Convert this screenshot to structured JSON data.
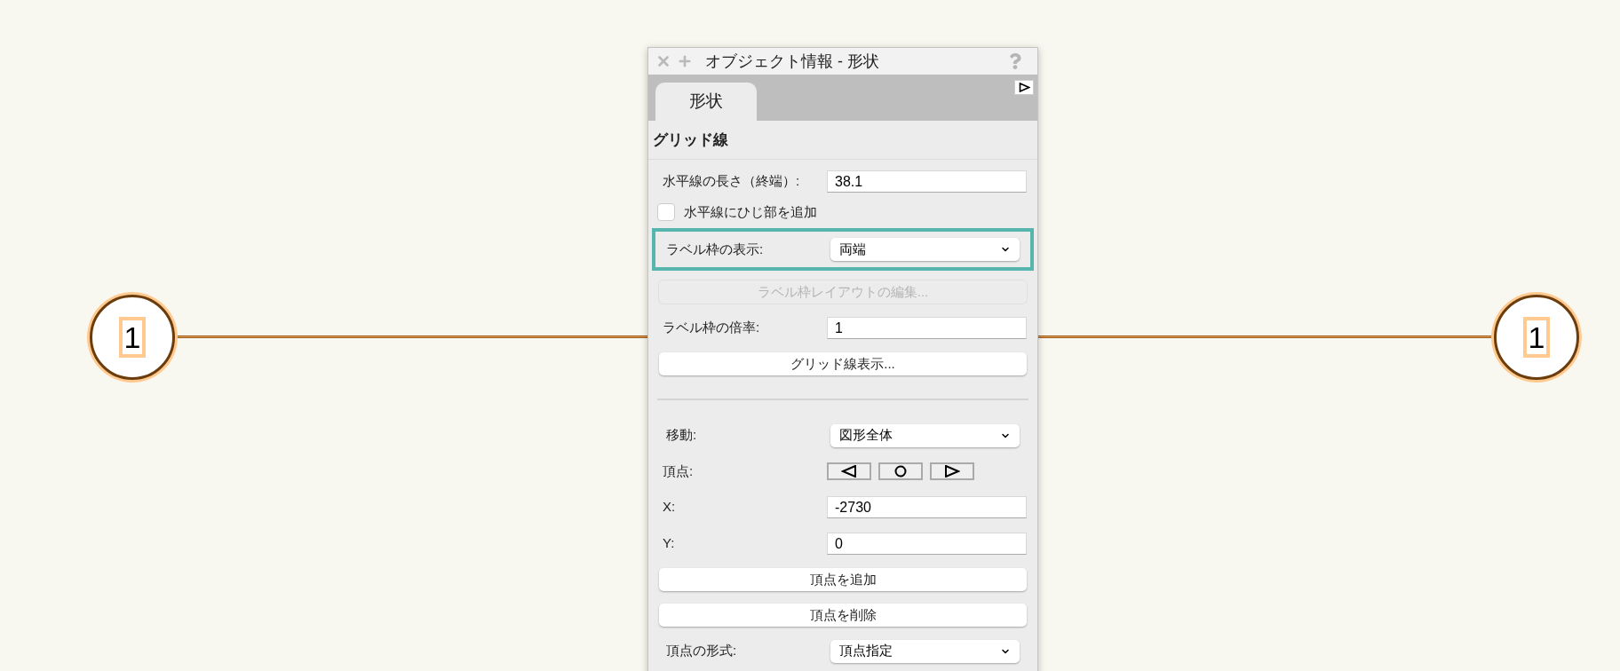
{
  "canvas": {
    "grid_line": {
      "bubbles": [
        {
          "label": "1"
        },
        {
          "label": "1"
        }
      ]
    }
  },
  "panel": {
    "title": "オブジェクト情報 - 形状",
    "tabs": [
      {
        "label": "形状",
        "selected": true
      }
    ],
    "section_title": "グリッド線",
    "rows": [
      {
        "kind": "field",
        "label": "水平線の長さ（終端）:",
        "value": "38.1"
      },
      {
        "kind": "checkbox",
        "label": "水平線にひじ部を追加",
        "checked": false
      },
      {
        "kind": "select",
        "label": "ラベル枠の表示:",
        "value": "両端",
        "highlighted": true
      },
      {
        "kind": "button",
        "label": "ラベル枠レイアウトの編集...",
        "disabled": true
      },
      {
        "kind": "field",
        "label": "ラベル枠の倍率:",
        "value": "1"
      },
      {
        "kind": "button",
        "label": "グリッド線表示...",
        "disabled": false
      },
      {
        "kind": "divider"
      },
      {
        "kind": "select",
        "label": "移動:",
        "value": "図形全体",
        "highlighted": false
      },
      {
        "kind": "vertex_nav",
        "label": "頂点:"
      },
      {
        "kind": "field",
        "label": "X:",
        "value": "-2730"
      },
      {
        "kind": "field",
        "label": "Y:",
        "value": "0"
      },
      {
        "kind": "button",
        "label": "頂点を追加",
        "disabled": false
      },
      {
        "kind": "button",
        "label": "頂点を削除",
        "disabled": false
      },
      {
        "kind": "select",
        "label": "頂点の形式:",
        "value": "頂点指定",
        "highlighted": false
      }
    ]
  }
}
